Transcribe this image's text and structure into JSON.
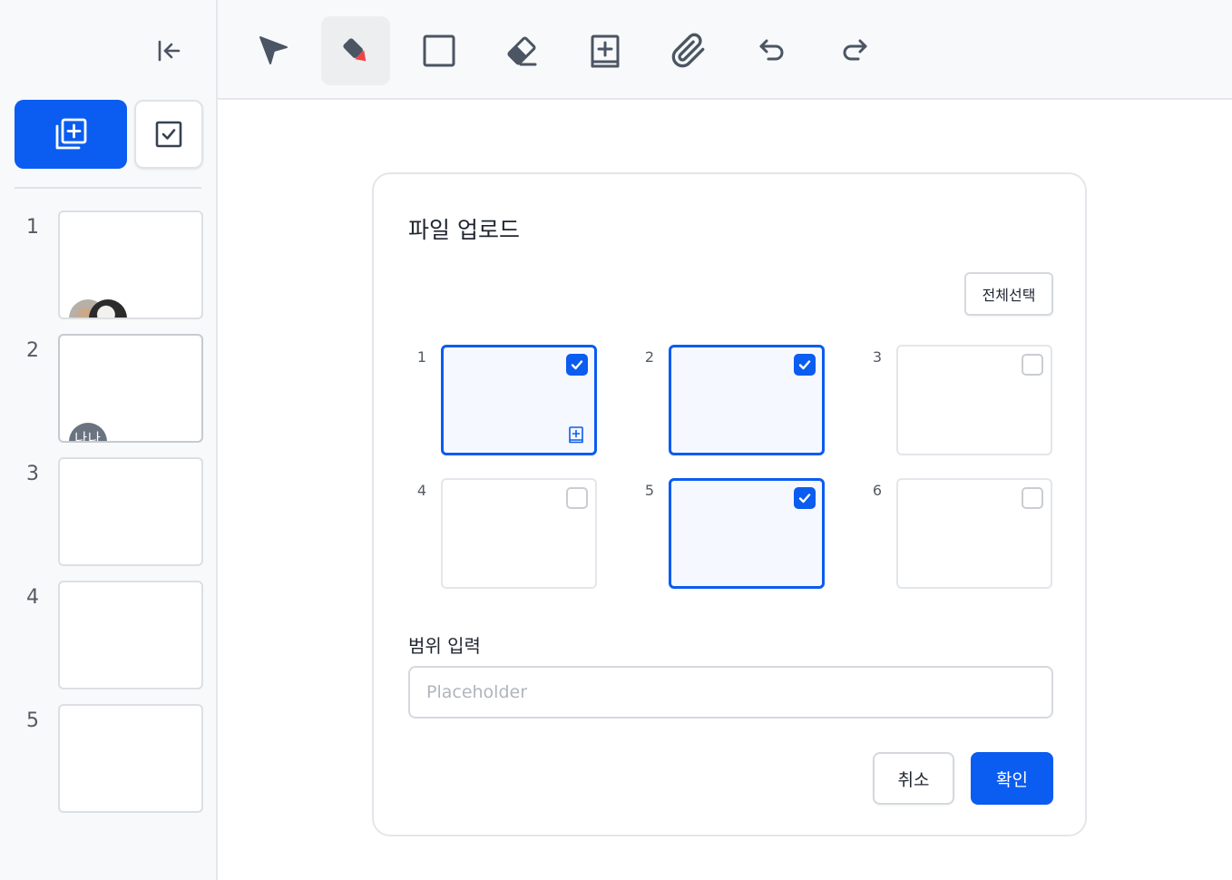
{
  "colors": {
    "accent": "#0b5cf0",
    "icon": "#4b5563",
    "pen_tip": "#ef4444"
  },
  "sidebar": {
    "collapse_icon": "collapse-left-icon",
    "add_page_icon": "add-page-icon",
    "select_mode_icon": "checkbox-icon",
    "pages": [
      {
        "number": "1",
        "avatars": [
          "user-photo-1",
          "user-photo-2"
        ]
      },
      {
        "number": "2",
        "avatars": [
          "user-initials"
        ]
      },
      {
        "number": "3",
        "avatars": []
      },
      {
        "number": "4",
        "avatars": []
      },
      {
        "number": "5",
        "avatars": []
      }
    ],
    "page2_avatar_initials": "나나"
  },
  "toolbar": {
    "tools": [
      {
        "name": "select",
        "icon": "pointer-arrow-icon",
        "selected": false
      },
      {
        "name": "pen",
        "icon": "marker-pen-icon",
        "selected": true
      },
      {
        "name": "rectangle",
        "icon": "square-icon",
        "selected": false
      },
      {
        "name": "eraser",
        "icon": "eraser-icon",
        "selected": false
      },
      {
        "name": "add-page",
        "icon": "add-page-icon",
        "selected": false
      },
      {
        "name": "attach",
        "icon": "paperclip-icon",
        "selected": false
      },
      {
        "name": "undo",
        "icon": "undo-icon",
        "selected": false
      },
      {
        "name": "redo",
        "icon": "redo-icon",
        "selected": false
      }
    ]
  },
  "dialog": {
    "title": "파일 업로드",
    "select_all_label": "전체선택",
    "pages": [
      {
        "number": "1",
        "checked": true
      },
      {
        "number": "2",
        "checked": true
      },
      {
        "number": "3",
        "checked": false
      },
      {
        "number": "4",
        "checked": false
      },
      {
        "number": "5",
        "checked": true
      },
      {
        "number": "6",
        "checked": false
      }
    ],
    "range_label": "범위 입력",
    "range_placeholder": "Placeholder",
    "range_value": "",
    "cancel_label": "취소",
    "confirm_label": "확인"
  }
}
